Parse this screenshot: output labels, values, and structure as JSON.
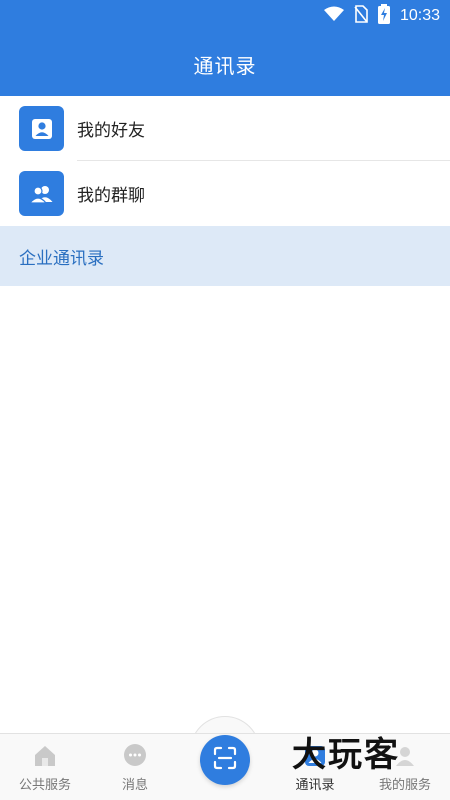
{
  "status_bar": {
    "time": "10:33",
    "icons": [
      "wifi-icon",
      "no-sim-icon",
      "battery-charging-icon"
    ]
  },
  "header": {
    "title": "通讯录"
  },
  "contacts": {
    "items": [
      {
        "label": "我的好友",
        "icon": "person-icon"
      },
      {
        "label": "我的群聊",
        "icon": "group-icon"
      }
    ],
    "section_label": "企业通讯录"
  },
  "bottom_nav": {
    "items": [
      {
        "label": "公共服务",
        "icon": "home-icon",
        "active": false
      },
      {
        "label": "消息",
        "icon": "chat-icon",
        "active": false
      },
      {
        "label": "",
        "icon": "scan-icon",
        "active": false
      },
      {
        "label": "通讯录",
        "icon": "contacts-icon",
        "active": true
      },
      {
        "label": "我的服务",
        "icon": "profile-icon",
        "active": false
      }
    ]
  },
  "watermark": {
    "text": "大玩客"
  },
  "colors": {
    "primary": "#2f7ddf",
    "section_bg": "#dde9f7",
    "section_text": "#2a6fc0"
  }
}
